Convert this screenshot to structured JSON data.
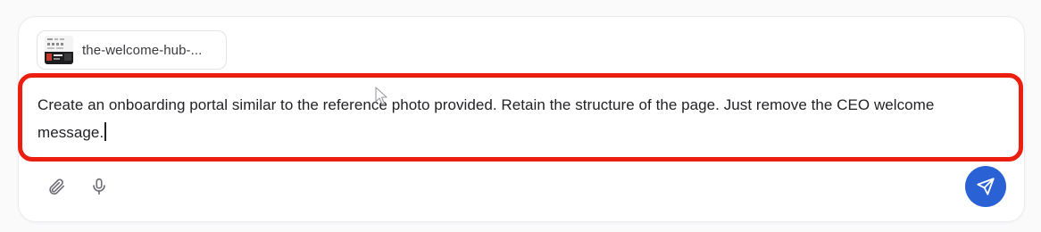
{
  "attachment": {
    "file_label": "the-welcome-hub-..."
  },
  "prompt": {
    "text": "Create an onboarding portal similar to the reference photo provided. Retain the structure of the page. Just remove the CEO welcome message."
  },
  "toolbar": {
    "attach_icon": "paperclip-icon",
    "mic_icon": "microphone-icon",
    "send_icon": "send-icon"
  },
  "colors": {
    "highlight_border": "#ea1f10",
    "send_button": "#2a62d6",
    "text": "#222227"
  }
}
